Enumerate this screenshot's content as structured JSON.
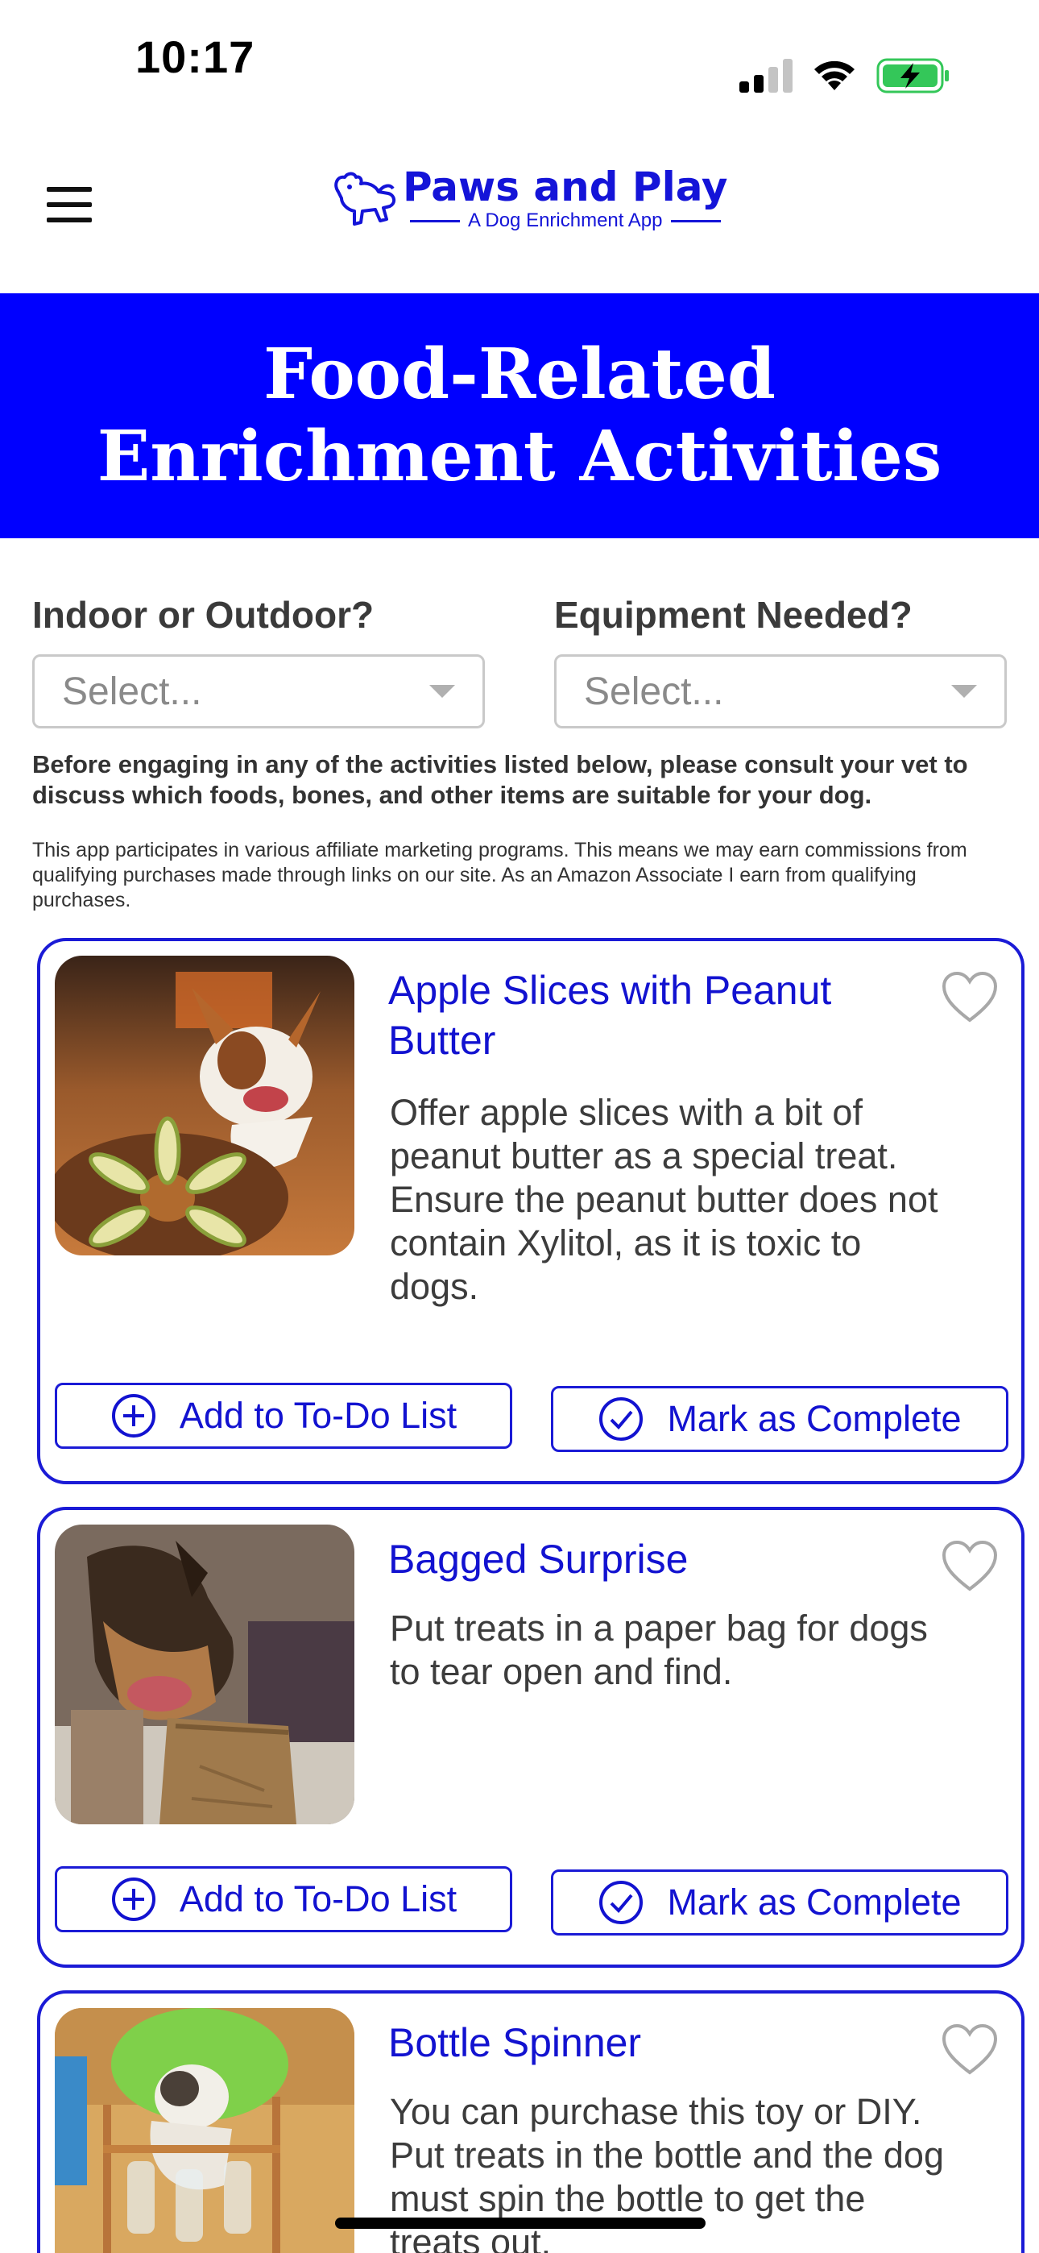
{
  "status_bar": {
    "time": "10:17"
  },
  "header": {
    "logo_title": "Paws and Play",
    "logo_subtitle": "A Dog Enrichment App"
  },
  "banner": {
    "title": "Food-Related Enrichment Activities"
  },
  "filters": [
    {
      "label": "Indoor or Outdoor?",
      "placeholder": "Select..."
    },
    {
      "label": "Equipment Needed?",
      "placeholder": "Select..."
    }
  ],
  "notices": {
    "vet": "Before engaging in any of the activities listed below, please consult your vet to discuss which foods, bones, and other items are suitable for your dog.",
    "affiliate": "This app participates in various affiliate marketing programs. This means we may earn commissions from qualifying purchases made through links on our site. As an Amazon Associate I earn from qualifying purchases."
  },
  "buttons": {
    "add_todo": "Add to To-Do List",
    "mark_complete": "Mark as Complete"
  },
  "activities": [
    {
      "title": "Apple Slices with Peanut Butter",
      "description": "Offer apple slices with a bit of peanut butter as a special treat. Ensure the peanut butter does not contain Xylitol, as it is toxic to dogs."
    },
    {
      "title": "Bagged Surprise",
      "description": "Put treats in a paper bag for dogs to tear open and find."
    },
    {
      "title": "Bottle Spinner",
      "description": "You can purchase this toy or DIY. Put treats in the bottle and the dog must spin the bottle to get the treats out."
    }
  ],
  "colors": {
    "brand_blue": "#0000ff",
    "accent_blue": "#1b1bd6",
    "battery_green": "#34c759"
  }
}
